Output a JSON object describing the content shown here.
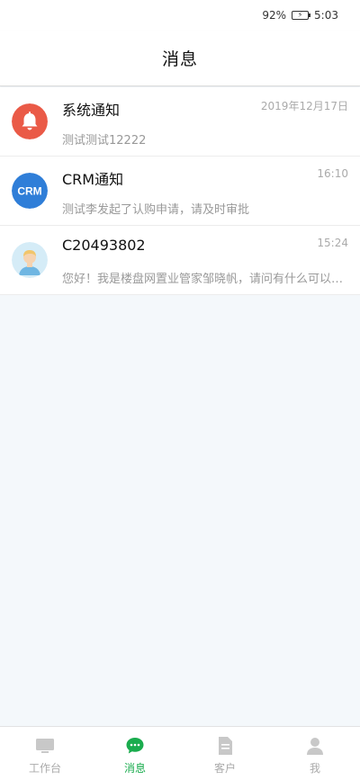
{
  "status_bar": {
    "battery": "92%",
    "time": "5:03"
  },
  "header": {
    "title": "消息"
  },
  "messages": [
    {
      "title": "系统通知",
      "time": "2019年12月17日",
      "preview": "测试测试12222",
      "avatar": "bell-icon",
      "avatar_color": "#ea5a47"
    },
    {
      "title": "CRM通知",
      "time": "16:10",
      "preview": "测试李发起了认购申请，请及时审批",
      "avatar": "crm-icon",
      "avatar_text": "CRM",
      "avatar_color": "#2f7ed8"
    },
    {
      "title": "C20493802",
      "time": "15:24",
      "preview": "您好！我是楼盘网置业管家邹晓帆，请问有什么可以帮您？",
      "avatar": "user-avatar-icon",
      "avatar_color": "#d5ecf7"
    }
  ],
  "tabbar": {
    "tabs": [
      {
        "label": "工作台",
        "icon": "monitor-icon"
      },
      {
        "label": "消息",
        "icon": "chat-bubble-icon",
        "active": true
      },
      {
        "label": "客户",
        "icon": "document-icon"
      },
      {
        "label": "我",
        "icon": "person-icon"
      }
    ]
  },
  "colors": {
    "accent": "#1aac4e",
    "inactive": "#aaaaaa",
    "background": "#f4f8fb"
  }
}
